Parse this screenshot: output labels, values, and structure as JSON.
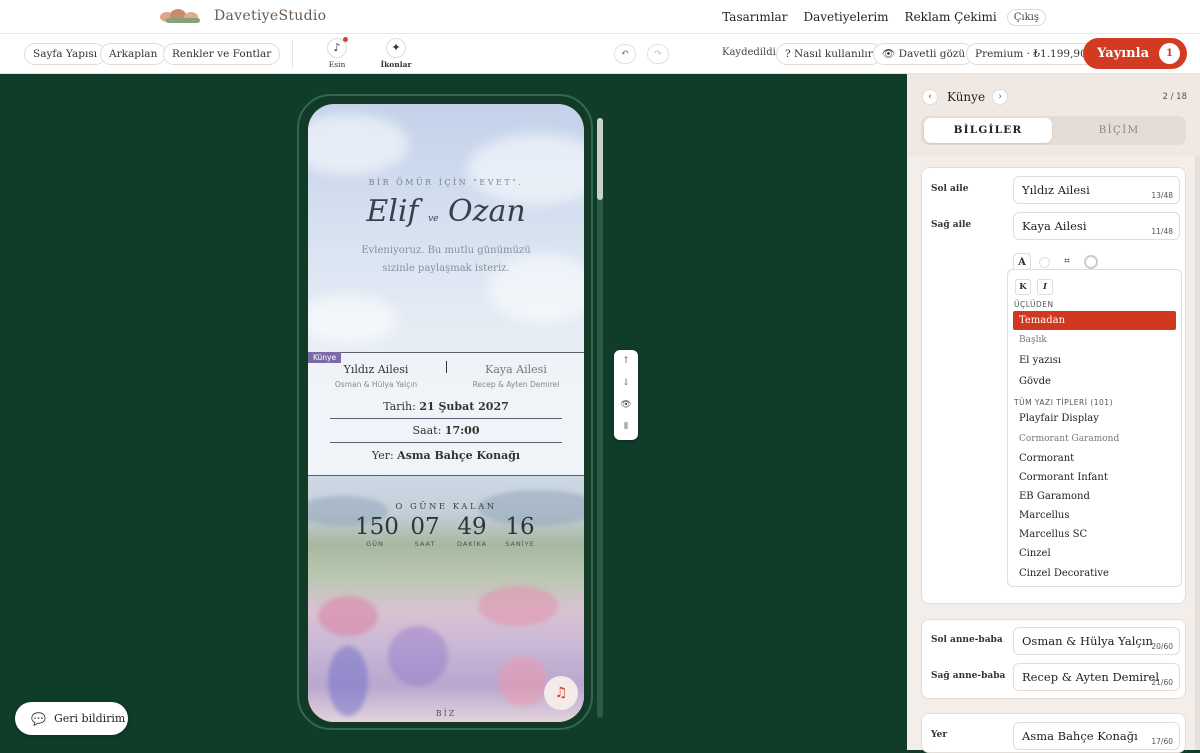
{
  "app": {
    "logo_text": "DavetiyeStudio"
  },
  "nav": {
    "items": [
      "Tasarımlar",
      "Davetiyelerim",
      "Reklam Çekimi"
    ],
    "exit": "Çıkış"
  },
  "toolbar": {
    "left_pills": [
      "Sayfa Yapısı",
      "Arkaplan",
      "Renkler ve Fontlar"
    ],
    "tools": [
      {
        "label": "Esin",
        "icon": "music-note-icon"
      },
      {
        "label": "İkonlar",
        "icon": "sparkle-icon"
      }
    ],
    "undo": "↶",
    "redo": "↷",
    "saved": "Kaydedildi",
    "help": "? Nasıl kullanılır",
    "guest_view": "Davetli gözü",
    "premium": "Premium · ₺1.199,90",
    "publish": "Yayınla",
    "publish_badge": "1"
  },
  "preview": {
    "hero_subtitle": "BİR ÖMÜR İÇİN \"EVET\".",
    "bride": "Elif",
    "ve": "ve",
    "groom": "Ozan",
    "message": "Evleniyoruz. Bu mutlu günümüzü sizinle paylaşmak isteriz.",
    "section_tag": "Künye",
    "left_family": "Yıldız Ailesi",
    "left_parents": "Osman & Hülya Yalçın",
    "right_family": "Kaya Ailesi",
    "right_parents": "Recep & Ayten Demirel",
    "date_label": "Tarih:",
    "date_value": "21 Şubat 2027",
    "time_label": "Saat:",
    "time_value": "17:00",
    "place_label": "Yer:",
    "place_value": "Asma Bahçe Konağı",
    "countdown_title": "O GÜNE KALAN",
    "countdown": [
      {
        "value": "150",
        "label": "GÜN"
      },
      {
        "value": "07",
        "label": "SAAT"
      },
      {
        "value": "49",
        "label": "DAKİKA"
      },
      {
        "value": "16",
        "label": "SANİYE"
      }
    ],
    "footer": "BİZ"
  },
  "side_controls": [
    "↑",
    "↓",
    "👁",
    "⦀"
  ],
  "feedback": "Geri bildirim",
  "panel": {
    "title": "Künye",
    "page_count": "2 / 18",
    "tabs": [
      "BİLGİLER",
      "BİÇİM"
    ],
    "fields_top": [
      {
        "label": "Sol aile",
        "value": "Yıldız Ailesi",
        "count": "13/48"
      },
      {
        "label": "Sağ aile",
        "value": "Kaya Ailesi",
        "count": "11/48"
      }
    ],
    "format": {
      "bold": "K",
      "italic": "I",
      "section_quick": "ÜÇLÜDEN",
      "section_all": "TÜM YAZI TİPLERİ (101)"
    },
    "quick_fonts": [
      "Temadan",
      "Başlık",
      "El yazısı",
      "Gövde"
    ],
    "all_fonts": [
      "Playfair Display",
      "Cormorant Garamond",
      "Cormorant",
      "Cormorant Infant",
      "EB Garamond",
      "Marcellus",
      "Marcellus SC",
      "Cinzel",
      "Cinzel Decorative"
    ],
    "fields_parents": [
      {
        "label": "Sol anne-baba",
        "value": "Osman & Hülya Yalçın",
        "count": "20/60"
      },
      {
        "label": "Sağ anne-baba",
        "value": "Recep & Ayten Demirel",
        "count": "21/60"
      }
    ],
    "field_place": {
      "label": "Yer",
      "value": "Asma Bahçe Konağı",
      "count": "17/60"
    }
  },
  "colors": {
    "accent": "#d23a22",
    "canvas_bg": "#0f3d2a",
    "tag": "#7a6aa8"
  }
}
